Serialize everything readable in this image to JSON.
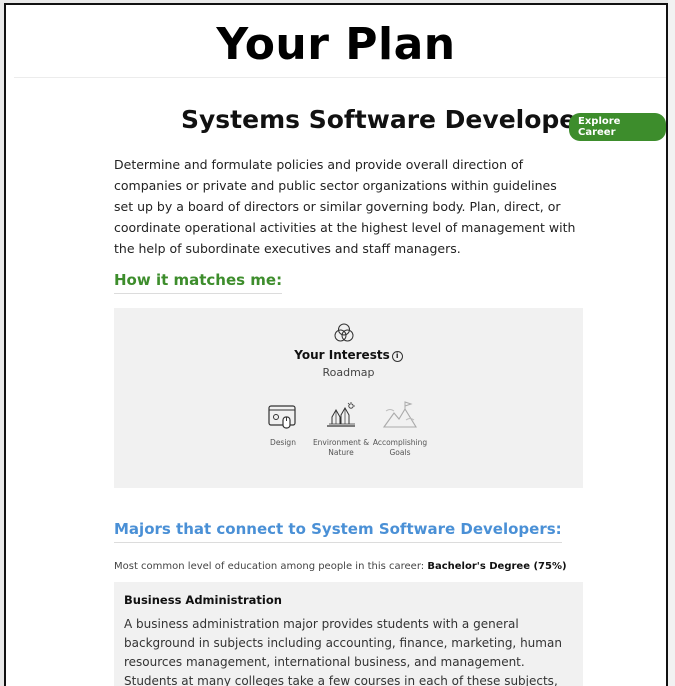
{
  "page": {
    "title": "Your Plan"
  },
  "career": {
    "title": "Systems Software Developer",
    "explore_label": "Explore Career",
    "description": "Determine and formulate policies and provide overall direction of companies or private and public sector organizations within guidelines set up by a board of directors or similar governing body. Plan, direct, or coordinate operational activities at the highest level of management with the help of subordinate executives and staff managers."
  },
  "matches": {
    "heading": "How it matches me:",
    "interests_title": "Your Interests",
    "interests_subtitle": "Roadmap",
    "items": [
      {
        "icon": "design-icon",
        "label": "Design"
      },
      {
        "icon": "environment-nature-icon",
        "label": "Environment & Nature"
      },
      {
        "icon": "accomplishing-goals-icon",
        "label": "Accomplishing Goals"
      }
    ]
  },
  "majors": {
    "heading": "Majors that connect to System Software Developers:",
    "education_prefix": "Most common level of education among people in this career:",
    "education_value": "Bachelor's Degree (75%)",
    "items": [
      {
        "name": "Business Administration",
        "description": "A business administration major provides students with a general background in subjects including accounting, finance, marketing, human resources management, international business, and management. Students at many colleges take a few courses in each of these subjects, but some schools require"
      }
    ]
  },
  "colors": {
    "green": "#3d8d2c",
    "blue": "#4a90d6",
    "panel": "#f1f1f1"
  }
}
